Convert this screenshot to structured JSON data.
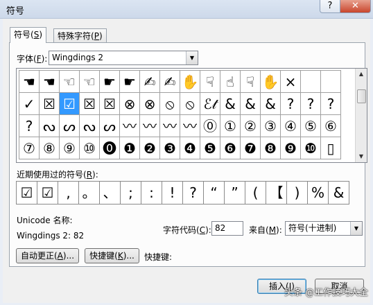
{
  "window": {
    "title": "符号",
    "help_glyph": "?",
    "close_glyph": "✕"
  },
  "tabs": [
    {
      "label": "符号(",
      "key": "S",
      "end": ")"
    },
    {
      "label": "特殊字符(",
      "key": "P",
      "end": ")"
    }
  ],
  "font": {
    "label": "字体(",
    "key": "F",
    "end": "):",
    "value": "Wingdings 2"
  },
  "symbol_grid": {
    "rows": [
      [
        "☚",
        "☚",
        "☜",
        "☜",
        "☛",
        "☛",
        "✍",
        "✍",
        "✋",
        "☟",
        "☝",
        "☟",
        "✋",
        "×"
      ],
      [
        "✓",
        "☒",
        "☑",
        "☒",
        "☒",
        "⊗",
        "⊗",
        "⦸",
        "⦸",
        "ℰ𝓉",
        "&",
        "&",
        "&",
        "?",
        "?",
        "?"
      ],
      [
        "?",
        "ᔓ",
        "ᔕ",
        "ᔓ",
        "ᔕ",
        "〰",
        "〰",
        "〰",
        "〰",
        "⓪",
        "①",
        "②",
        "③",
        "④",
        "⑤",
        "⑥"
      ],
      [
        "⑦",
        "⑧",
        "⑨",
        "⑩",
        "⓿",
        "❶",
        "❷",
        "❸",
        "❹",
        "❺",
        "❻",
        "❼",
        "❽",
        "❾",
        "❿",
        "▯"
      ]
    ],
    "selected": "☑"
  },
  "recent": {
    "label": "近期使用过的符号(",
    "key": "R",
    "end": "):",
    "items": [
      "☑",
      "☑",
      ",",
      "。",
      "、",
      ";",
      ":",
      "!",
      "?",
      "“",
      "”",
      "(",
      "【",
      ")",
      "%",
      "&"
    ]
  },
  "unicode_name_label": "Unicode 名称:",
  "symbol_name": "Wingdings 2: 82",
  "char_code": {
    "label": "字符代码(",
    "key": "C",
    "end": "):",
    "value": "82"
  },
  "from": {
    "label": "来自(",
    "key": "M",
    "end": "):",
    "value": "符号(十进制)"
  },
  "buttons": {
    "autocorrect": {
      "label": "自动更正(",
      "key": "A",
      "end": ")..."
    },
    "shortcut_key": {
      "label": "快捷键(",
      "key": "K",
      "end": ")..."
    },
    "insert": {
      "label": "插入(",
      "key": "I",
      "end": ")"
    },
    "cancel": "取消"
  },
  "shortcut_label": "快捷键:",
  "watermark": "头条 @工作技巧大全"
}
